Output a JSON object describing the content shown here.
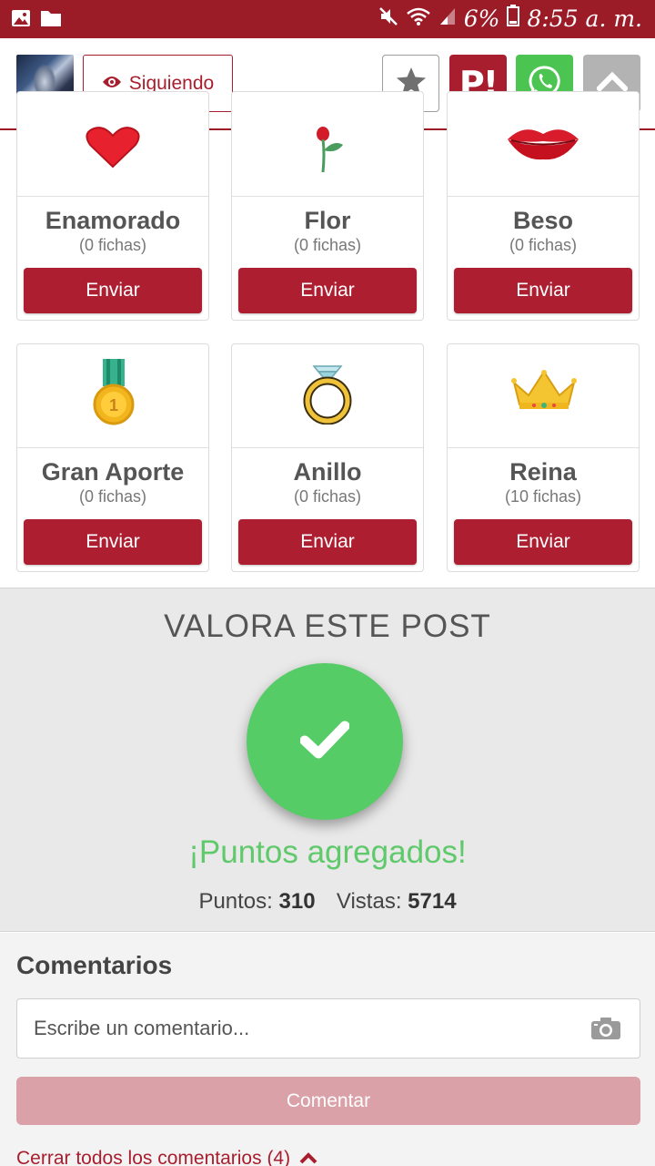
{
  "status_bar": {
    "left_icons": [
      "image-icon",
      "folder-icon"
    ],
    "right_icons": [
      "mute-icon",
      "wifi-icon",
      "signal-icon",
      "battery-icon"
    ],
    "battery": "6%",
    "time": "8:55 a. m."
  },
  "header": {
    "follow_label": "Siguiendo",
    "icons": [
      "eye-icon",
      "star-icon",
      "whatsapp-icon",
      "chevron-up-icon"
    ],
    "p_label": "P!",
    "colors": {
      "brand": "#a81e2e",
      "whatsapp": "#4cc452",
      "neutral": "#b3b3b3"
    }
  },
  "medals": [
    {
      "name": "Enamorado",
      "chips": "(0 fichas)",
      "button": "Enviar",
      "icon": "heart-icon"
    },
    {
      "name": "Flor",
      "chips": "(0 fichas)",
      "button": "Enviar",
      "icon": "rose-icon"
    },
    {
      "name": "Beso",
      "chips": "(0 fichas)",
      "button": "Enviar",
      "icon": "lips-icon"
    },
    {
      "name": "Gran Aporte",
      "chips": "(0 fichas)",
      "button": "Enviar",
      "icon": "medal-icon"
    },
    {
      "name": "Anillo",
      "chips": "(0 fichas)",
      "button": "Enviar",
      "icon": "ring-icon"
    },
    {
      "name": "Reina",
      "chips": "(10 fichas)",
      "button": "Enviar",
      "icon": "crown-icon"
    }
  ],
  "medal_badge_number": "1",
  "rating": {
    "title": "VALORA ESTE POST",
    "added_message": "¡Puntos agregados!",
    "points_label": "Puntos:",
    "points_value": "310",
    "views_label": "Vistas:",
    "views_value": "5714",
    "success_color": "#55cc66"
  },
  "comments": {
    "title": "Comentarios",
    "placeholder": "Escribe un comentario...",
    "submit_label": "Comentar",
    "close_all_label": "Cerrar todos los comentarios (4)"
  }
}
